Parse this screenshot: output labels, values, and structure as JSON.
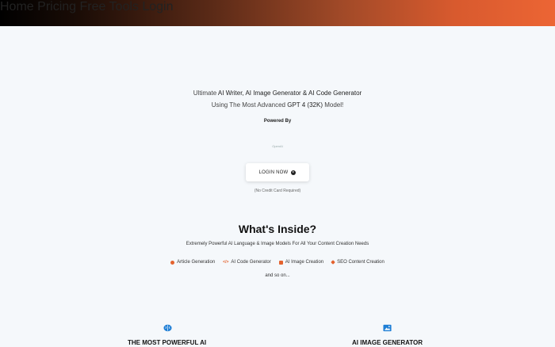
{
  "nav": {
    "items": [
      "Home",
      "Pricing",
      "Free Tools",
      "Login"
    ]
  },
  "hero": {
    "line1_pre": "Ultimate ",
    "line1_highlight": "AI Writer, AI Image Generator & AI Code Generator",
    "line2_pre": "Using The Most Advanced ",
    "line2_highlight": "GPT 4 (32K)",
    "line2_post": " Model!",
    "powered_by": "Powered By",
    "openai_logo": "OpenAI",
    "login_button": "LOGIN NOW",
    "no_credit_card": "(No Credit Card Required)"
  },
  "inside": {
    "title": "What's Inside?",
    "subtitle": "Extremely Powerful AI Language & Image Models For All Your Content Creation Needs",
    "features": [
      "Article Generation",
      "AI Code Generator",
      "AI Image Creation",
      "SEO Content Creation"
    ],
    "and_so_on": "and so on..."
  },
  "columns": [
    {
      "title": "THE MOST POWERFUL AI",
      "icon": "brain-icon"
    },
    {
      "title": "AI IMAGE GENERATOR",
      "icon": "image-icon"
    }
  ],
  "colors": {
    "accent": "#e4632f",
    "background": "#f5f8fb",
    "brain_icon": "#1f7fd6"
  }
}
